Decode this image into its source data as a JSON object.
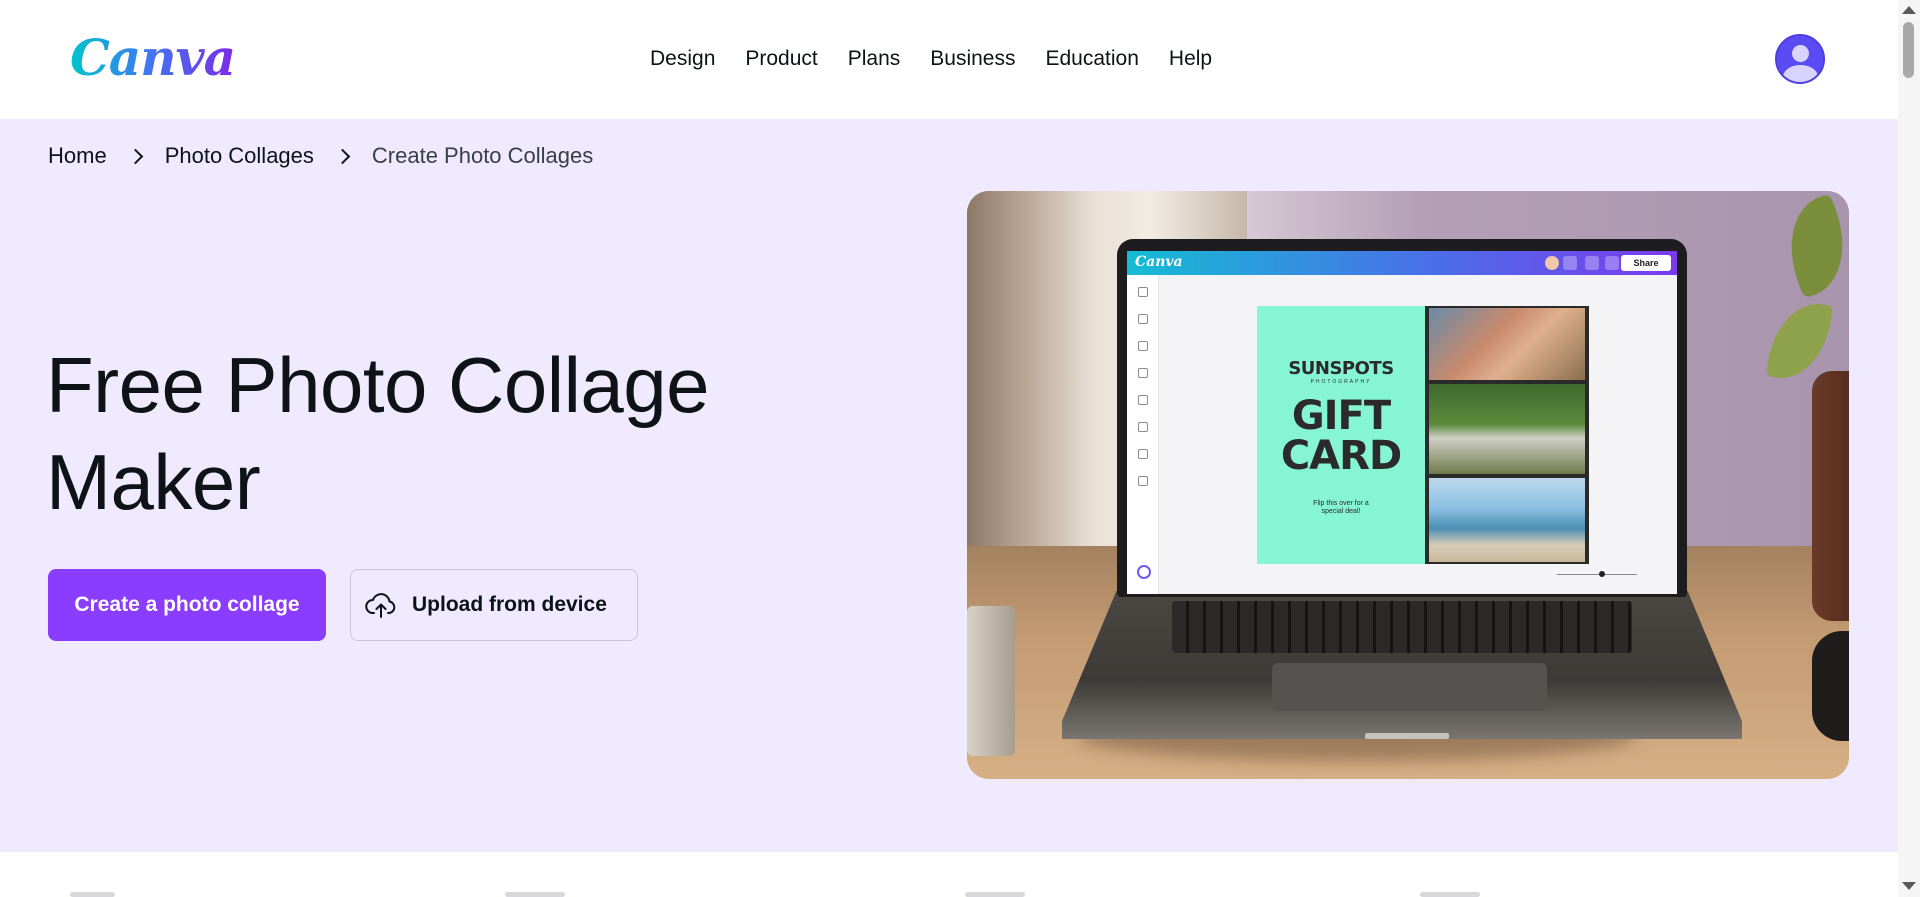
{
  "header": {
    "logo": "Canva",
    "nav": [
      {
        "label": "Design"
      },
      {
        "label": "Product"
      },
      {
        "label": "Plans"
      },
      {
        "label": "Business"
      },
      {
        "label": "Education"
      },
      {
        "label": "Help"
      }
    ],
    "avatar_icon": "user-avatar-icon"
  },
  "breadcrumb": [
    {
      "label": "Home"
    },
    {
      "label": "Photo Collages"
    },
    {
      "label": "Create Photo Collages"
    }
  ],
  "hero": {
    "title": "Free Photo Collage Maker",
    "primary_button": "Create a photo collage",
    "secondary_button": "Upload from device",
    "secondary_icon": "cloud-upload-icon"
  },
  "hero_image": {
    "editor_logo": "Canva",
    "share_label": "Share",
    "gift_card": {
      "brand": "SUNSPOTS",
      "brand_sub": "PHOTOGRAPHY",
      "title_line1": "GIFT",
      "title_line2": "CARD",
      "note": "Flip this over for a special deal!"
    }
  },
  "colors": {
    "primary": "#8b3dff",
    "hero_background": "#efeafd",
    "text": "#0e1318"
  }
}
